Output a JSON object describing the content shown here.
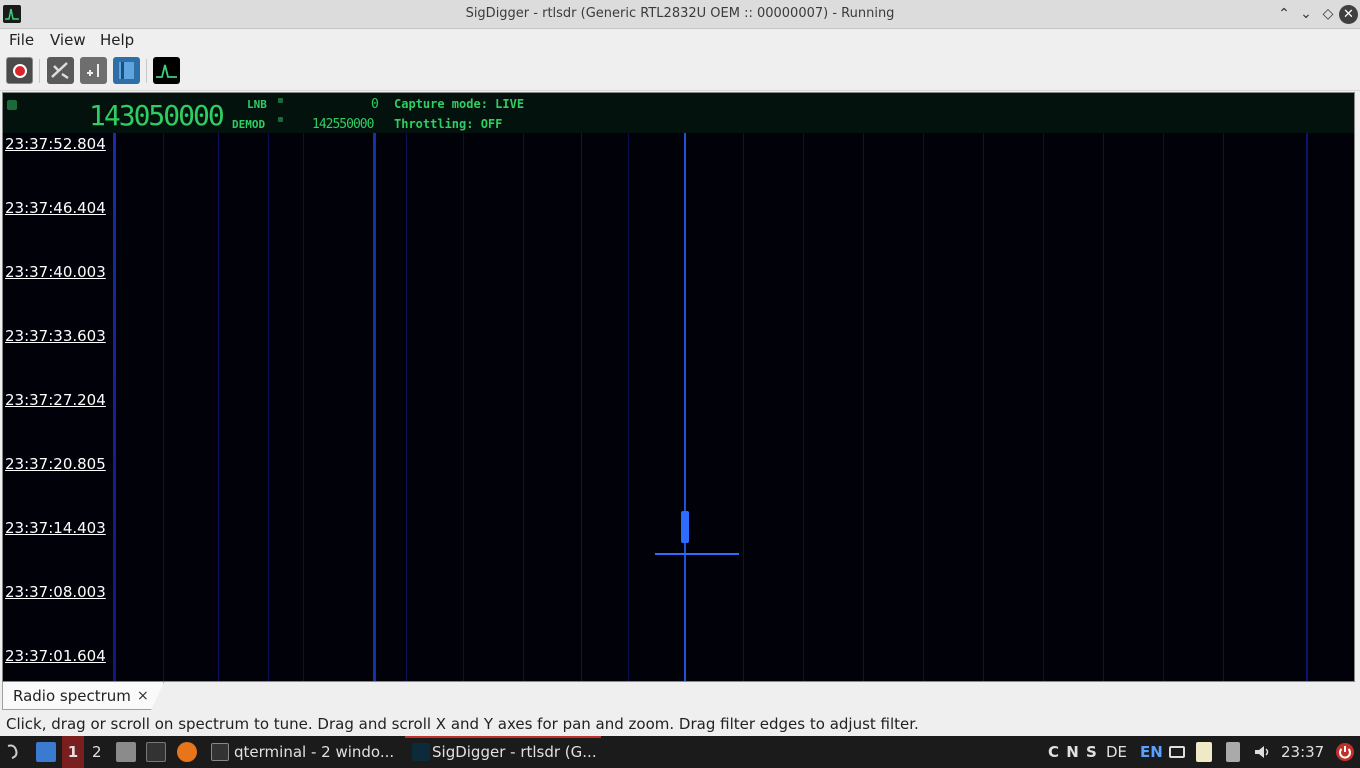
{
  "window": {
    "title": "SigDigger - rtlsdr (Generic RTL2832U OEM :: 00000007) - Running",
    "buttons": {
      "minimize": "⌃",
      "maximize": "⌄",
      "restore": "◇",
      "close": "✕"
    }
  },
  "menu": {
    "file": "File",
    "view": "View",
    "help": "Help"
  },
  "toolbar": {
    "icons": [
      "record-stop-icon",
      "settings-icon",
      "panoramic-icon",
      "bookmarks-icon",
      "spectrum-icon"
    ]
  },
  "header": {
    "frequency": "143050000",
    "lnb_label": "LNB",
    "lnb_value": "0",
    "demod_label": "DEMOD",
    "demod_value": "142550000",
    "capture_mode": "Capture mode: LIVE",
    "throttling": "Throttling: OFF",
    "text_color": "#2fcd62"
  },
  "waterfall": {
    "timestamps": [
      "23:37:52.804",
      "23:37:46.404",
      "23:37:40.003",
      "23:37:33.603",
      "23:37:27.204",
      "23:37:20.805",
      "23:37:14.403",
      "23:37:08.003",
      "23:37:01.604"
    ],
    "background": "#01010a",
    "signal_color": "#1e5bff"
  },
  "tabs": [
    {
      "label": "Radio spectrum",
      "close": "×"
    }
  ],
  "status": "Click, drag or scroll on spectrum to tune. Drag and scroll X and Y axes for pan and zoom. Drag filter edges to adjust filter.",
  "taskbar": {
    "workspace1": "1",
    "workspace2": "2",
    "task_terminal": "qterminal - 2 windo...",
    "task_sigdigger": "SigDigger - rtlsdr (G...",
    "tray_text": "C N S",
    "layout_de": "DE",
    "layout_en": "EN",
    "clock": "23:37"
  }
}
